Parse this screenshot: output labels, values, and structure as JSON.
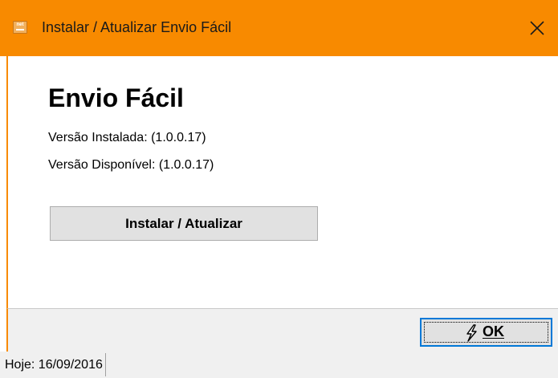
{
  "window": {
    "title": "Instalar / Atualizar Envio Fácil",
    "app_icon_text": "net",
    "icons": {
      "app": "app-icon",
      "close": "close-icon"
    },
    "accent_color": "#f88a00"
  },
  "content": {
    "heading": "Envio Fácil",
    "installed_version": "Versão Instalada: (1.0.0.17)",
    "available_version": "Versão Disponível: (1.0.0.17)",
    "install_button_label": "Instalar / Atualizar"
  },
  "footer": {
    "ok_label": "OK",
    "ok_icon": "lightning-icon"
  },
  "status_bar": {
    "date_text": "Hoje: 16/09/2016"
  }
}
